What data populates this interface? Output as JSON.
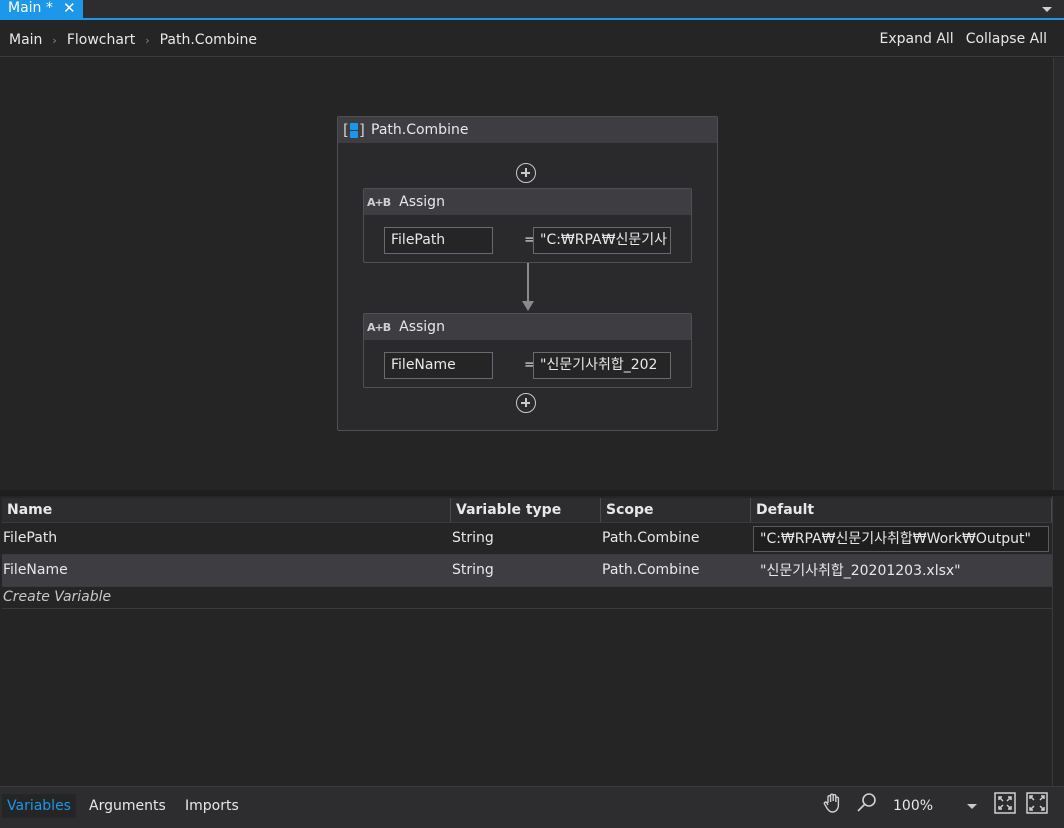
{
  "tab": {
    "title": "Main *",
    "close": "✕"
  },
  "breadcrumb": {
    "items": [
      "Main",
      "Flowchart",
      "Path.Combine"
    ],
    "separator": "›"
  },
  "toolbar": {
    "expand_all": "Expand All",
    "collapse_all": "Collapse All"
  },
  "sequence": {
    "title": "Path.Combine",
    "activities": [
      {
        "title": "Assign",
        "icon_text": "A+B",
        "to": "FilePath",
        "equals": "=",
        "value": "\"C:₩RPA₩신문기사"
      },
      {
        "title": "Assign",
        "icon_text": "A+B",
        "to": "FileName",
        "equals": "=",
        "value": "\"신문기사취합_202"
      }
    ]
  },
  "variables": {
    "columns": [
      "Name",
      "Variable type",
      "Scope",
      "Default"
    ],
    "rows": [
      {
        "name": "FilePath",
        "type": "String",
        "scope": "Path.Combine",
        "default": "\"C:₩RPA₩신문기사취합₩Work₩Output\""
      },
      {
        "name": "FileName",
        "type": "String",
        "scope": "Path.Combine",
        "default": "\"신문기사취합_20201203.xlsx\""
      }
    ],
    "create_label": "Create Variable"
  },
  "bottom_tabs": {
    "variables": "Variables",
    "arguments": "Arguments",
    "imports": "Imports"
  },
  "zoom": "100%",
  "icons": [
    "hand-pan-icon",
    "zoom-search-icon",
    "fit-to-screen-icon",
    "overview-icon"
  ],
  "colors": {
    "accent": "#1c97ea",
    "background": "#252526"
  }
}
